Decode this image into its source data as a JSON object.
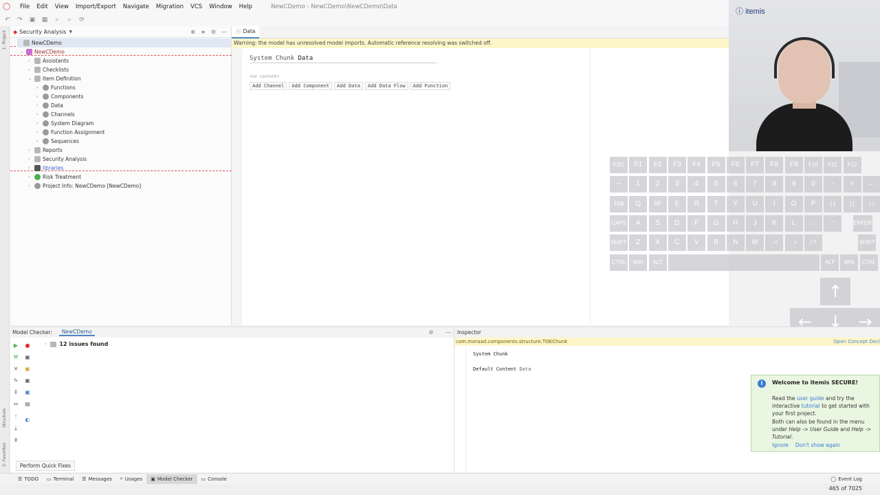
{
  "menu": {
    "items": [
      "File",
      "Edit",
      "View",
      "Import/Export",
      "Navigate",
      "Migration",
      "VCS",
      "Window",
      "Help"
    ],
    "window_title": "NewCDemo - NewCDemo\\NewCDemo\\Data"
  },
  "project_panel": {
    "title": "Security Analysis",
    "tree": [
      {
        "label": "NewCDemo",
        "level": 0
      },
      {
        "label": "NewCDemo",
        "level": 1
      },
      {
        "label": "Assistants",
        "level": 2
      },
      {
        "label": "Checklists",
        "level": 2
      },
      {
        "label": "Item Definition",
        "level": 2
      },
      {
        "label": "Functions",
        "level": 3
      },
      {
        "label": "Components",
        "level": 3
      },
      {
        "label": "Data",
        "level": 3
      },
      {
        "label": "Channels",
        "level": 3
      },
      {
        "label": "System Diagram",
        "level": 3
      },
      {
        "label": "Function Assignment",
        "level": 3
      },
      {
        "label": "Sequences",
        "level": 3
      },
      {
        "label": "Reports",
        "level": 2
      },
      {
        "label": "Security Analysis",
        "level": 2
      },
      {
        "label": "libraries",
        "level": 2
      },
      {
        "label": "Risk Treatment",
        "level": 2
      },
      {
        "label": "Project Info: NewCDemo [NewCDemo]",
        "level": 2
      }
    ]
  },
  "editor": {
    "tab": "Data",
    "warning": "Warning: the model has unresolved model imports. Automatic reference resolving was switched off.",
    "title_kw": "System Chunk",
    "title_name": "Data",
    "no_content": "<no content>",
    "actions": [
      "Add Channel",
      "Add Component",
      "Add Data",
      "Add Data Flow",
      "Add Function"
    ]
  },
  "webcam": {
    "brand": "itemis"
  },
  "keyboard": {
    "row1": [
      "ESC",
      "F1",
      "F2",
      "F3",
      "F4",
      "F5",
      "F6",
      "F7",
      "F8",
      "F9",
      "F10",
      "F11",
      "F12"
    ],
    "row2": [
      "~",
      "1",
      "2",
      "3",
      "4",
      "5",
      "6",
      "7",
      "8",
      "9",
      "0",
      "-",
      "=",
      "←"
    ],
    "row3": [
      "TAB",
      "Q",
      "W",
      "E",
      "R",
      "T",
      "Y",
      "U",
      "I",
      "O",
      "P",
      "[ {",
      "] }",
      "\\ |"
    ],
    "row4": [
      "CAPS",
      "A",
      "S",
      "D",
      "F",
      "G",
      "H",
      "J",
      "K",
      "L",
      "; :",
      "' \"",
      "ENTER"
    ],
    "row5": [
      "SHIFT",
      "Z",
      "X",
      "C",
      "V",
      "B",
      "N",
      "M",
      ", <",
      ". >",
      "/ ?",
      "SHIFT"
    ],
    "row6": [
      "CTRL",
      "WIN",
      "ALT",
      "",
      "ALT",
      "WIN",
      "CTRL"
    ],
    "arrows": [
      "↑",
      "←",
      "↓",
      "→"
    ]
  },
  "model_checker": {
    "label": "Model Checker:",
    "tab": "NewCDemo",
    "issues": "12 issues found",
    "quick_fix": "Perform Quick Fixes"
  },
  "inspector": {
    "title": "Inspector",
    "concept": "com.moraad.components.structure.TOEChunk",
    "open_concept": "Open Concept Decl",
    "line1": "System Chunk",
    "line2_kw": "Default Content",
    "line2_val": "Data"
  },
  "notification": {
    "title": "Welcome to itemis SECURE!",
    "p1_a": "Read the ",
    "p1_link1": "user guide",
    "p1_b": " and try the interactive ",
    "p1_link2": "tutorial",
    "p1_c": " to get started with your first project.",
    "p2_a": "Both can also be found in the menu under ",
    "p2_b": "Help -> User Guide",
    "p2_c": " and ",
    "p2_d": "Help -> Tutorial",
    "p2_e": ".",
    "ignore": "Ignore",
    "dont_show": "Don't show again"
  },
  "statusbar": {
    "items": [
      "TODO",
      "Terminal",
      "Messages",
      "Usages",
      "Model Checker",
      "Console"
    ],
    "active": "Model Checker",
    "event_log": "Event Log",
    "position": "465 of 7025"
  },
  "side_labels": {
    "project": "1: Project",
    "structure": "Structure",
    "favorites": "2: Favorites"
  }
}
